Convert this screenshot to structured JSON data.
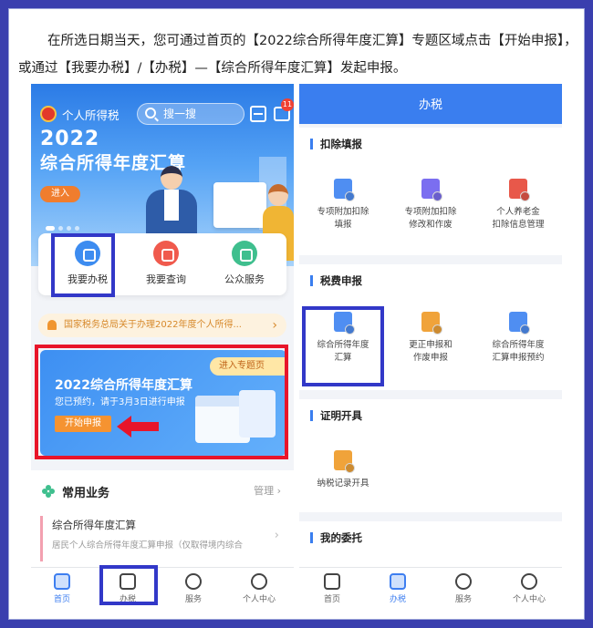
{
  "intro": {
    "text": "在所选日期当天，您可通过首页的【2022综合所得年度汇算】专题区域点击【开始申报】，或通过【我要办税】/【办税】—【综合所得年度汇算】发起申报。"
  },
  "left_phone": {
    "app_name": "个人所得税",
    "search_placeholder": "搜一搜",
    "message_count": "11",
    "banner": {
      "year": "2022",
      "title": "综合所得年度汇算",
      "enter": "进入"
    },
    "quick": [
      {
        "label": "我要办税",
        "icon": "pen-icon",
        "color": "#3d8cf0"
      },
      {
        "label": "我要查询",
        "icon": "search-icon",
        "color": "#f05a4d"
      },
      {
        "label": "公众服务",
        "icon": "service-icon",
        "color": "#3fbf8e"
      }
    ],
    "notice": "国家税务总局关于办理2022年度个人所得...",
    "promo": {
      "title": "2022综合所得年度汇算",
      "subtitle": "您已预约，请于3月3日进行申报",
      "button": "开始申报",
      "enter_topic": "进入专题页"
    },
    "common": {
      "title": "常用业务",
      "manage": "管理",
      "item_title": "综合所得年度汇算",
      "item_desc": "居民个人综合所得年度汇算申报（仅取得境内综合"
    },
    "tabs": [
      {
        "label": "首页",
        "active": true
      },
      {
        "label": "办税",
        "active": false
      },
      {
        "label": "服务",
        "active": false
      },
      {
        "label": "个人中心",
        "active": false
      }
    ]
  },
  "right_phone": {
    "header": "办税",
    "sections": [
      {
        "title": "扣除填报",
        "items": [
          "专项附加扣除\n填报",
          "专项附加扣除\n修改和作废",
          "个人养老金\n扣除信息管理"
        ]
      },
      {
        "title": "税费申报",
        "items": [
          "综合所得年度\n汇算",
          "更正申报和\n作废申报",
          "综合所得年度\n汇算申报预约"
        ]
      },
      {
        "title": "证明开具",
        "items": [
          "纳税记录开具"
        ]
      },
      {
        "title": "我的委托",
        "items": []
      }
    ],
    "tabs": [
      {
        "label": "首页",
        "active": false
      },
      {
        "label": "办税",
        "active": true
      },
      {
        "label": "服务",
        "active": false
      },
      {
        "label": "个人中心",
        "active": false
      }
    ]
  },
  "colors": {
    "highlight_blue": "#3238c8",
    "highlight_red": "#e8152a",
    "accent": "#3a7eef"
  }
}
